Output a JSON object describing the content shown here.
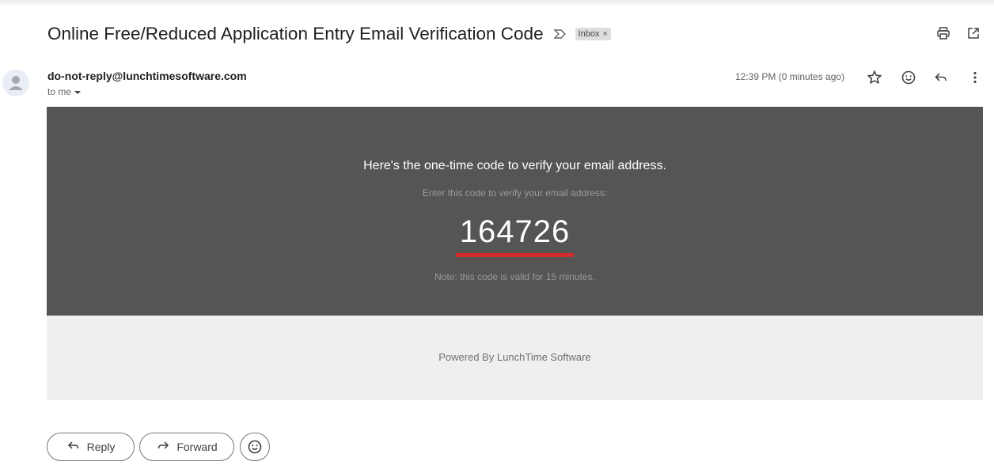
{
  "email": {
    "subject": "Online Free/Reduced Application Entry Email Verification Code",
    "label": "Inbox",
    "label_close": "×",
    "sender": "do-not-reply@lunchtimesoftware.com",
    "recipient": "to me",
    "time": "12:39 PM (0 minutes ago)"
  },
  "body": {
    "headline": "Here's the one-time code to verify your email address.",
    "instruction": "Enter this code to verify your email address:",
    "code": "164726",
    "note": "Note: this code is valid for 15 minutes.",
    "footer": "Powered By LunchTime Software",
    "code_underline_color": "#d22b2b"
  },
  "actions": {
    "reply_label": "Reply",
    "forward_label": "Forward"
  },
  "icons": {
    "top": [
      "print-icon",
      "open-in-new-window-icon"
    ],
    "header": [
      "star-icon",
      "emoji-react-icon",
      "reply-icon",
      "more-vert-icon"
    ],
    "footer": [
      "reply-icon",
      "forward-icon",
      "emoji-react-icon"
    ]
  }
}
